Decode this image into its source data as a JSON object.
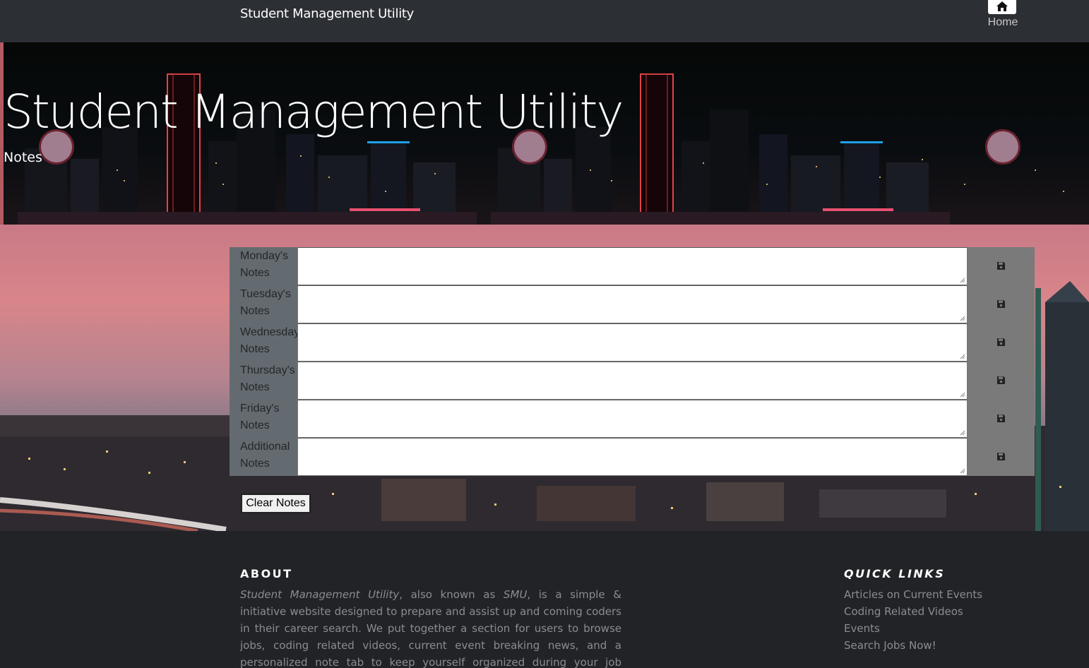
{
  "navbar": {
    "brand": "Student Management Utility",
    "home_label": "Home",
    "home_icon": "home-icon"
  },
  "hero": {
    "title": "Student Management Utility",
    "subtitle": "Notes"
  },
  "notes": {
    "rows": [
      {
        "label_line1": "Monday's",
        "label_line2": "Notes",
        "value": "",
        "save_icon": "floppy-disk-icon"
      },
      {
        "label_line1": "Tuesday's",
        "label_line2": "Notes",
        "value": "",
        "save_icon": "floppy-disk-icon"
      },
      {
        "label_line1": "Wednesday's",
        "label_line2": "Notes",
        "value": "",
        "save_icon": "floppy-disk-icon"
      },
      {
        "label_line1": "Thursday's",
        "label_line2": "Notes",
        "value": "",
        "save_icon": "floppy-disk-icon"
      },
      {
        "label_line1": "Friday's",
        "label_line2": "Notes",
        "value": "",
        "save_icon": "floppy-disk-icon"
      },
      {
        "label_line1": "Additional",
        "label_line2": "Notes",
        "value": "",
        "save_icon": "floppy-disk-icon"
      }
    ],
    "clear_label": "Clear Notes"
  },
  "footer": {
    "about_title": "ABOUT",
    "about_text_1": "Student Management Utility",
    "about_text_2": ", also known as ",
    "about_text_3": "SMU",
    "about_text_4": ", is a simple & initiative website designed to prepare and assist up and coming coders in their career search. We put together a section for users to browse jobs, coding related videos, current event breaking news, and a personalized note tab to keep yourself organized during your job search.",
    "quick_title": "QUICK LINKS",
    "links": [
      "Articles on Current Events",
      "Coding Related Videos",
      "Events",
      "Search Jobs Now!"
    ]
  },
  "colors": {
    "navbar": "#2c2f34",
    "label_bg": "#646b70",
    "save_bg": "#7a7a7a",
    "footer": "#212327"
  }
}
